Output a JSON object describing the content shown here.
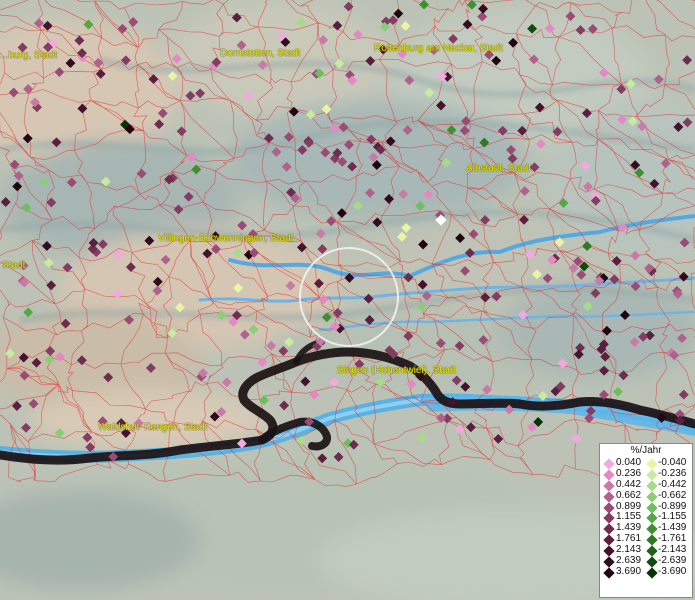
{
  "cities": [
    {
      "name": "Rottenburg am Neckar, Stadt",
      "dot": true
    },
    {
      "name": "Dornstetten, Stadt",
      "dot": false
    },
    {
      "name": "...burg, Stadt",
      "dot": false
    },
    {
      "name": "Albstadt, Stadt",
      "dot": false
    },
    {
      "name": "Villingen-Schwenningen, Stadt",
      "dot": false
    },
    {
      "name": "Stadt",
      "dot": false
    },
    {
      "name": "Singen (Hohentwiel), Stadt",
      "dot": false
    },
    {
      "name": "Waldshut-Tiengen, Stadt",
      "dot": false
    }
  ],
  "legend": {
    "title": "%/Jahr",
    "rows": [
      {
        "pos": "0.040",
        "pos_color": "#f2a9e0",
        "neg": "-0.040",
        "neg_color": "#e8f5a6"
      },
      {
        "pos": "0.236",
        "pos_color": "#e389c3",
        "neg": "-0.236",
        "neg_color": "#c7eba1"
      },
      {
        "pos": "0.442",
        "pos_color": "#c97aa6",
        "neg": "-0.442",
        "neg_color": "#a6dc88"
      },
      {
        "pos": "0.662",
        "pos_color": "#b0618c",
        "neg": "-0.662",
        "neg_color": "#8cce78"
      },
      {
        "pos": "0.899",
        "pos_color": "#9a4c76",
        "neg": "-0.899",
        "neg_color": "#6fbe5d"
      },
      {
        "pos": "1.155",
        "pos_color": "#843c62",
        "neg": "-1.155",
        "neg_color": "#54a843"
      },
      {
        "pos": "1.439",
        "pos_color": "#6e2c4f",
        "neg": "-1.439",
        "neg_color": "#3e9130"
      },
      {
        "pos": "1.761",
        "pos_color": "#5a1f3e",
        "neg": "-1.761",
        "neg_color": "#2c7a22"
      },
      {
        "pos": "2.143",
        "pos_color": "#46132e",
        "neg": "-2.143",
        "neg_color": "#1e6218"
      },
      {
        "pos": "2.639",
        "pos_color": "#330a1f",
        "neg": "-2.639",
        "neg_color": "#134a10"
      },
      {
        "pos": "3.690",
        "pos_color": "#200510",
        "neg": "-3.690",
        "neg_color": "#0a3208"
      }
    ]
  }
}
